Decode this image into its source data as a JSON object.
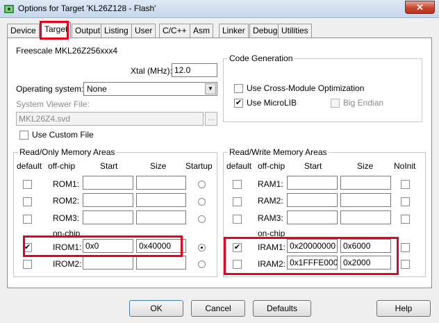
{
  "window": {
    "title": "Options for Target 'KL26Z128 - Flash'",
    "close_glyph": "✕"
  },
  "tabs": [
    "Device",
    "Target",
    "Output",
    "Listing",
    "User",
    "C/C++",
    "Asm",
    "Linker",
    "Debug",
    "Utilities"
  ],
  "device": {
    "name": "Freescale MKL26Z256xxx4",
    "xtal_label": "Xtal (MHz):",
    "xtal_value": "12.0",
    "os_label": "Operating system:",
    "os_value": "None",
    "svd_label": "System Viewer File:",
    "svd_value": "MKL26Z4.svd",
    "browse_label": "...",
    "custom_file_label": "Use Custom File",
    "custom_file_checked": false
  },
  "code_gen": {
    "title": "Code Generation",
    "cross_module_label": "Use Cross-Module Optimization",
    "cross_module_checked": false,
    "microlib_label": "Use MicroLIB",
    "microlib_checked": true,
    "big_endian_label": "Big Endian",
    "big_endian_checked": false
  },
  "rom": {
    "title": "Read/Only Memory Areas",
    "headers": {
      "default": "default",
      "offchip": "off-chip",
      "start": "Start",
      "size": "Size",
      "startup": "Startup"
    },
    "onchip_label": "on-chip",
    "rows": [
      {
        "label": "ROM1:",
        "start": "",
        "size": "",
        "default": false,
        "startup": false
      },
      {
        "label": "ROM2:",
        "start": "",
        "size": "",
        "default": false,
        "startup": false
      },
      {
        "label": "ROM3:",
        "start": "",
        "size": "",
        "default": false,
        "startup": false
      },
      {
        "label": "IROM1:",
        "start": "0x0",
        "size": "0x40000",
        "default": true,
        "startup": true
      },
      {
        "label": "IROM2:",
        "start": "",
        "size": "",
        "default": false,
        "startup": false
      }
    ]
  },
  "ram": {
    "title": "Read/Write Memory Areas",
    "headers": {
      "default": "default",
      "offchip": "off-chip",
      "start": "Start",
      "size": "Size",
      "noinit": "NoInit"
    },
    "onchip_label": "on-chip",
    "rows": [
      {
        "label": "RAM1:",
        "start": "",
        "size": "",
        "default": false,
        "noinit": false
      },
      {
        "label": "RAM2:",
        "start": "",
        "size": "",
        "default": false,
        "noinit": false
      },
      {
        "label": "RAM3:",
        "start": "",
        "size": "",
        "default": false,
        "noinit": false
      },
      {
        "label": "IRAM1:",
        "start": "0x20000000",
        "size": "0x6000",
        "default": true,
        "noinit": false
      },
      {
        "label": "IRAM2:",
        "start": "0x1FFFE000",
        "size": "0x2000",
        "default": false,
        "noinit": false
      }
    ]
  },
  "buttons": {
    "ok": "OK",
    "cancel": "Cancel",
    "defaults": "Defaults",
    "help": "Help"
  },
  "colors": {
    "highlight": "#e8001c",
    "panel": "#ffffff",
    "dialog": "#f0f0f0"
  }
}
